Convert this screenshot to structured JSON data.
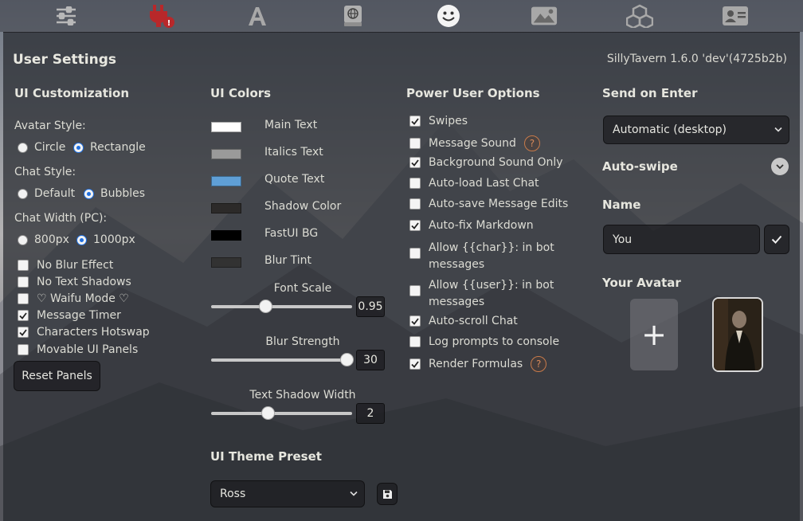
{
  "topbar": {
    "icons": [
      "sliders-icon",
      "plug-warning-icon",
      "font-icon",
      "book-icon",
      "smile-icon",
      "image-icon",
      "cubes-icon",
      "id-card-icon"
    ]
  },
  "panel": {
    "title": "User Settings",
    "version": "SillyTavern 1.6.0 'dev'(4725b2b)"
  },
  "ui_customization": {
    "heading": "UI Customization",
    "avatar_style_label": "Avatar Style:",
    "avatar_options": [
      "Circle",
      "Rectangle"
    ],
    "avatar_selected": "Rectangle",
    "chat_style_label": "Chat Style:",
    "chat_options": [
      "Default",
      "Bubbles"
    ],
    "chat_selected": "Bubbles",
    "chat_width_label": "Chat Width (PC):",
    "width_options": [
      "800px",
      "1000px"
    ],
    "width_selected": "1000px",
    "checkboxes": [
      {
        "label": "No Blur Effect",
        "checked": false
      },
      {
        "label": "No Text Shadows",
        "checked": false
      },
      {
        "label": "♡ Waifu Mode ♡",
        "checked": false
      },
      {
        "label": "Message Timer",
        "checked": true
      },
      {
        "label": "Characters Hotswap",
        "checked": true
      },
      {
        "label": "Movable UI Panels",
        "checked": false
      }
    ],
    "reset_button": "Reset Panels"
  },
  "ui_colors": {
    "heading": "UI Colors",
    "items": [
      {
        "label": "Main Text",
        "color": "#ffffff"
      },
      {
        "label": "Italics Text",
        "color": "#9a9a9a"
      },
      {
        "label": "Quote Text",
        "color": "#5f9fd6"
      },
      {
        "label": "Shadow Color",
        "color": "#2c2a29"
      },
      {
        "label": "FastUI BG",
        "color": "#000000"
      },
      {
        "label": "Blur Tint",
        "color": "#323232"
      }
    ],
    "sliders": [
      {
        "label": "Font Scale",
        "value": "0.95",
        "fraction": 0.38
      },
      {
        "label": "Blur Strength",
        "value": "30",
        "fraction": 1.0
      },
      {
        "label": "Text Shadow Width",
        "value": "2",
        "fraction": 0.4
      }
    ],
    "theme_heading": "UI Theme Preset",
    "theme_value": "Ross"
  },
  "power_user": {
    "heading": "Power User Options",
    "options": [
      {
        "label": "Swipes",
        "checked": true
      },
      {
        "label": "Message Sound",
        "checked": false,
        "help": "?"
      },
      {
        "label": "Background Sound Only",
        "checked": true
      },
      {
        "label": "Auto-load Last Chat",
        "checked": false
      },
      {
        "label": "Auto-save Message Edits",
        "checked": false
      },
      {
        "label": "Auto-fix Markdown",
        "checked": true
      },
      {
        "label": "Allow {{char}}: in bot",
        "label2": "messages",
        "checked": false
      },
      {
        "label": "Allow {{user}}: in bot",
        "label2": "messages",
        "checked": false
      },
      {
        "label": "Auto-scroll Chat",
        "checked": true
      },
      {
        "label": "Log prompts to console",
        "checked": false
      },
      {
        "label": "Render Formulas",
        "checked": true,
        "help": "?"
      }
    ]
  },
  "send_col": {
    "heading": "Send on Enter",
    "select_value": "Automatic (desktop)",
    "auto_swipe": "Auto-swipe",
    "name_heading": "Name",
    "name_value": "You",
    "avatar_heading": "Your Avatar",
    "add_glyph": "+"
  }
}
